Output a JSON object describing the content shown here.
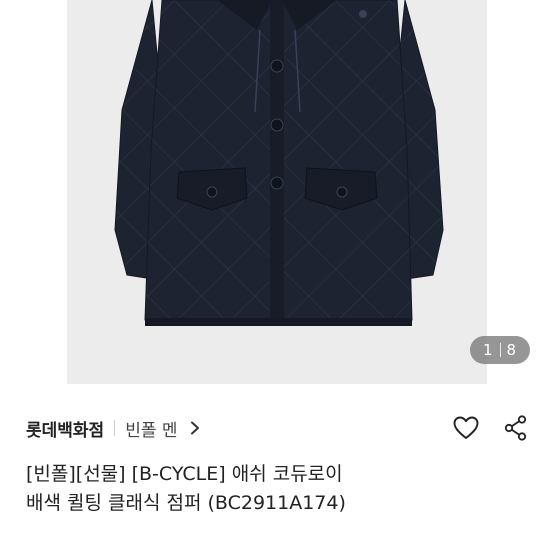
{
  "gallery": {
    "current_page": "1",
    "total_pages": "8"
  },
  "seller": {
    "store_name": "롯데백화점",
    "brand_name": "빈폴 멘"
  },
  "actions": {
    "like_icon": "heart-icon",
    "share_icon": "share-icon"
  },
  "product": {
    "title_line1": "[빈폴][선물] [B-CYCLE] 애쉬 코듀로이",
    "title_line2": "배색 퀼팅 클래식 점퍼 (BC2911A174)"
  },
  "colors": {
    "jacket": "#1c2230",
    "photo_background": "#ececec"
  }
}
